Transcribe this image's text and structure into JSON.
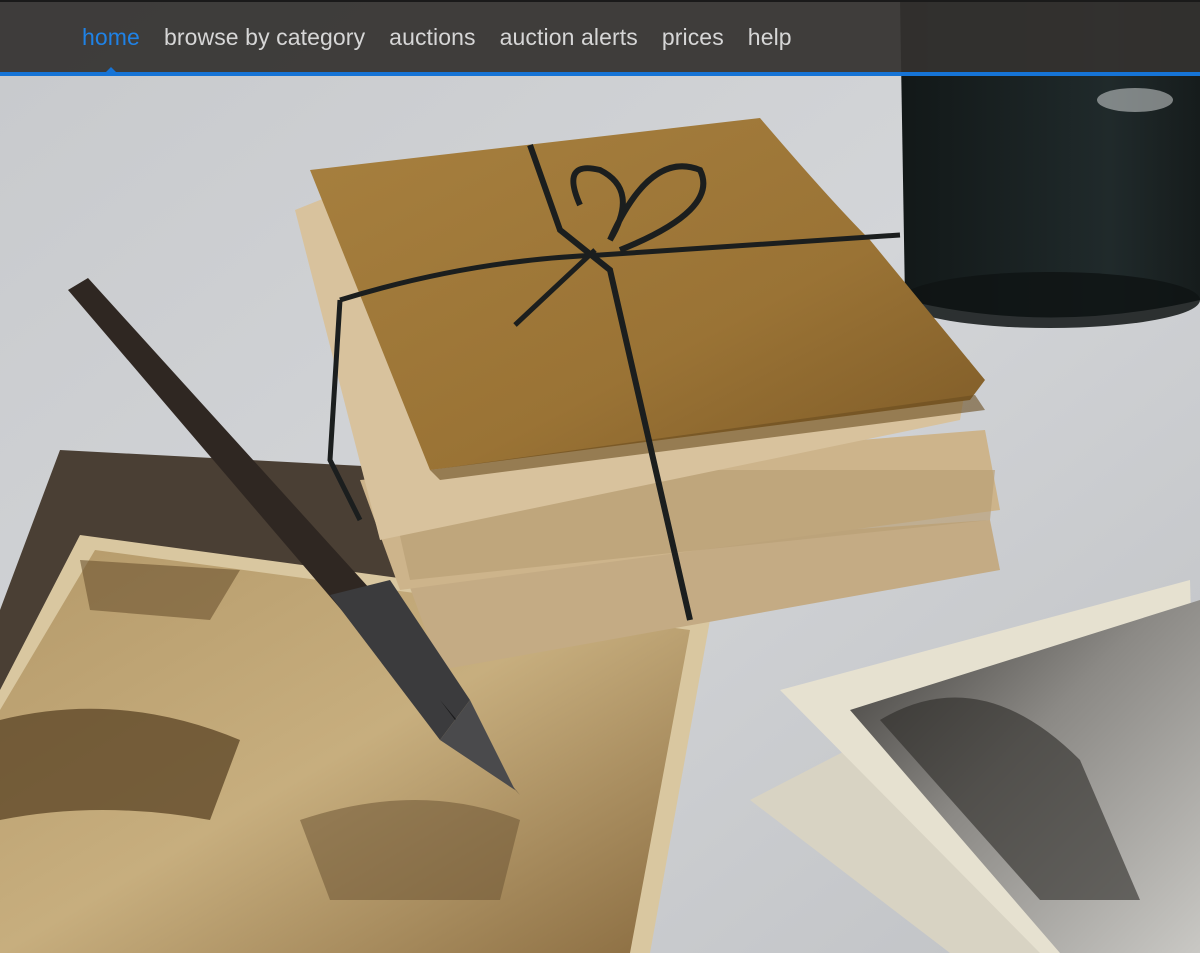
{
  "nav": {
    "items": [
      {
        "label": "home",
        "active": true
      },
      {
        "label": "browse by category",
        "active": false
      },
      {
        "label": "auctions",
        "active": false
      },
      {
        "label": "auction alerts",
        "active": false
      },
      {
        "label": "prices",
        "active": false
      },
      {
        "label": "help",
        "active": false
      }
    ],
    "accent_color": "#1674d6"
  },
  "hero": {
    "depicts": [
      "letters-bundle",
      "fountain-pen",
      "ink-bottle",
      "sepia-photographs"
    ]
  }
}
